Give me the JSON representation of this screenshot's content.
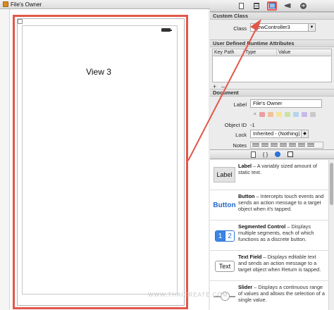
{
  "canvas": {
    "tab_title": "File's Owner",
    "view_title": "View 3"
  },
  "inspector": {
    "tabs": [
      "file-icon",
      "list-icon",
      "identity-icon",
      "ruler-icon",
      "connections-icon"
    ],
    "custom_class": {
      "header": "Custom Class",
      "class_label": "Class",
      "class_value": "ViewController3"
    },
    "runtime_attributes": {
      "header": "User Defined Runtime Attributes",
      "columns": [
        "Key Path",
        "Type",
        "Value"
      ],
      "add": "+",
      "remove": "–"
    },
    "document": {
      "header": "Document",
      "label_label": "Label",
      "label_value": "File's Owner",
      "label_clear": "×",
      "object_id_label": "Object ID",
      "object_id_value": "-1",
      "lock_label": "Lock",
      "lock_value": "Inherited - (Nothing)",
      "notes_label": "Notes",
      "swatch_colors": [
        "#e9a0a0",
        "#f0c39a",
        "#f3e49a",
        "#c9e3a6",
        "#b6d3ef",
        "#c8b9e9",
        "#c9c9c9"
      ]
    }
  },
  "library": {
    "tabs": [
      "file-icon",
      "braces-icon",
      "object-icon",
      "media-icon"
    ],
    "items": [
      {
        "icon_text": "Label",
        "title": "Label",
        "desc": " – A variably sized amount of static text."
      },
      {
        "icon_text": "Button",
        "title": "Button",
        "desc": " – Intercepts touch events and sends an action message to a target object when it's tapped."
      },
      {
        "icon_text_1": "1",
        "icon_text_2": "2",
        "title": "Segmented Control",
        "desc": " – Displays multiple segments, each of which functions as a discrete button."
      },
      {
        "icon_text": "Text",
        "title": "Text Field",
        "desc": " – Displays editable text and sends an action message to a target object when Return is tapped."
      },
      {
        "title": "Slider",
        "desc": " – Displays a continuous range of values and allows the selection of a single value."
      }
    ]
  },
  "watermark": "WWW.THAICREATE.COM",
  "colors": {
    "highlight": "#e2574a",
    "accent": "#2b73d9"
  }
}
